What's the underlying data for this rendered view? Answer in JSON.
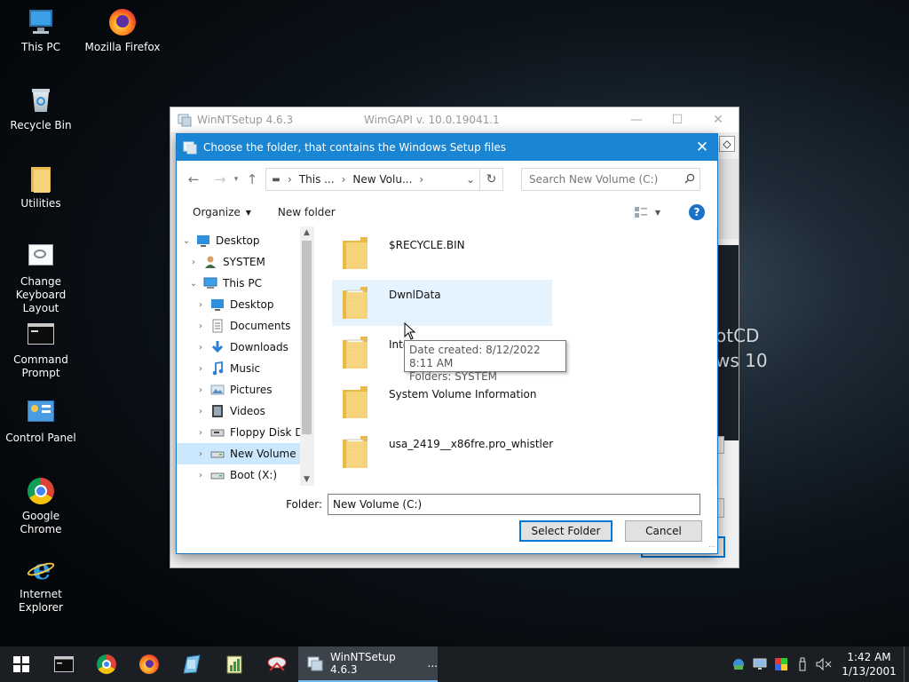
{
  "desktop": {
    "icons": [
      {
        "label": "This PC",
        "icon": "this-pc-icon"
      },
      {
        "label": "Mozilla Firefox",
        "icon": "firefox-icon"
      },
      {
        "label": "Recycle Bin",
        "icon": "recycle-bin-icon"
      },
      {
        "label": "Utilities",
        "icon": "folder-icon"
      },
      {
        "label": "Change Keyboard Layout",
        "icon": "keyboard-layout-icon"
      },
      {
        "label": "Command Prompt",
        "icon": "command-prompt-icon"
      },
      {
        "label": "Control Panel",
        "icon": "control-panel-icon"
      },
      {
        "label": "Google Chrome",
        "icon": "chrome-icon"
      },
      {
        "label": "Internet Explorer",
        "icon": "internet-explorer-icon"
      }
    ]
  },
  "bg_window": {
    "title": "WinNTSetup 4.6.3",
    "subtitle": "WimGAPI v. 10.0.19041.1",
    "splash_lines": [
      "otCD",
      "ws 10"
    ]
  },
  "dialog": {
    "title": "Choose the folder, that contains the Windows Setup files",
    "address": {
      "crumbs": [
        "This ...",
        "New Volu..."
      ]
    },
    "search_placeholder": "Search New Volume (C:)",
    "organize_label": "Organize",
    "new_folder_label": "New folder",
    "help_label": "?",
    "tree": [
      {
        "label": "Desktop",
        "icon": "desktop-icon",
        "chevron": "down",
        "indent": 0
      },
      {
        "label": "SYSTEM",
        "icon": "user-icon",
        "chevron": "right",
        "indent": 1
      },
      {
        "label": "This PC",
        "icon": "this-pc-icon",
        "chevron": "down",
        "indent": 1
      },
      {
        "label": "Desktop",
        "icon": "desktop-icon",
        "chevron": "right",
        "indent": 2
      },
      {
        "label": "Documents",
        "icon": "documents-icon",
        "chevron": "right",
        "indent": 2
      },
      {
        "label": "Downloads",
        "icon": "downloads-icon",
        "chevron": "right",
        "indent": 2
      },
      {
        "label": "Music",
        "icon": "music-icon",
        "chevron": "right",
        "indent": 2
      },
      {
        "label": "Pictures",
        "icon": "pictures-icon",
        "chevron": "right",
        "indent": 2
      },
      {
        "label": "Videos",
        "icon": "videos-icon",
        "chevron": "right",
        "indent": 2
      },
      {
        "label": "Floppy Disk Dri",
        "icon": "floppy-drive-icon",
        "chevron": "right",
        "indent": 2
      },
      {
        "label": "New Volume (C",
        "icon": "drive-icon",
        "chevron": "right",
        "indent": 2,
        "selected": true
      },
      {
        "label": "Boot (X:)",
        "icon": "drive-icon",
        "chevron": "right",
        "indent": 2
      }
    ],
    "files": [
      {
        "name": "$RECYCLE.BIN"
      },
      {
        "name": "DwnlData"
      },
      {
        "name": "Inter"
      },
      {
        "name": "System Volume Information"
      },
      {
        "name": "usa_2419__x86fre.pro_whistler"
      }
    ],
    "tooltip": {
      "line1": "Date created: 8/12/2022 8:11 AM",
      "line2": "Folders: SYSTEM"
    },
    "folder_label": "Folder:",
    "folder_value": "New Volume (C:)",
    "select_button": "Select Folder",
    "cancel_button": "Cancel"
  },
  "taskbar": {
    "active_app": "WinNTSetup 4.6.3",
    "active_app_suffix": "...",
    "time": "1:42 AM",
    "date": "1/13/2001"
  },
  "colors": {
    "title_blue": "#1a85d3",
    "selection": "#cce8ff",
    "hover": "#e5f3ff",
    "folder_yellow": "#f6d47a",
    "taskbar": "#1b1f24"
  }
}
